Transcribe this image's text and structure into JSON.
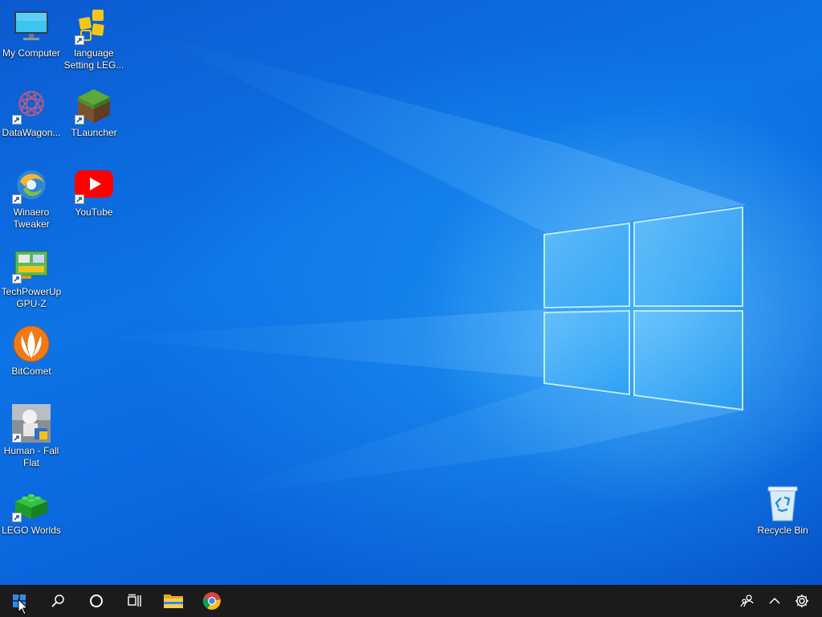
{
  "desktop": {
    "icons": [
      {
        "label": "My Computer",
        "icon": "monitor-icon"
      },
      {
        "label": "language Setting LEG...",
        "icon": "lego-settings-icon"
      },
      {
        "label": "DataWagon...",
        "icon": "datawagon-icon"
      },
      {
        "label": "TLauncher",
        "icon": "grass-block-icon"
      },
      {
        "label": "Winaero Tweaker",
        "icon": "winaero-icon"
      },
      {
        "label": "YouTube",
        "icon": "youtube-icon"
      },
      {
        "label": "TechPowerUp GPU-Z",
        "icon": "gpuz-icon"
      },
      {
        "label": "BitComet",
        "icon": "bitcomet-icon"
      },
      {
        "label": "Human - Fall Flat",
        "icon": "human-fall-flat-icon"
      },
      {
        "label": "LEGO Worlds",
        "icon": "lego-brick-icon"
      },
      {
        "label": "Recycle Bin",
        "icon": "recycle-bin-icon"
      }
    ]
  },
  "taskbar": {
    "buttons": [
      "start-icon",
      "search-icon",
      "cortana-icon",
      "task-view-icon",
      "file-explorer-icon",
      "chrome-icon"
    ],
    "tray": [
      "people-icon",
      "chevron-up-icon",
      "settings-gear-icon"
    ]
  },
  "colors": {
    "taskbar": "#1b1b1b",
    "desktop": "#0a63da"
  }
}
